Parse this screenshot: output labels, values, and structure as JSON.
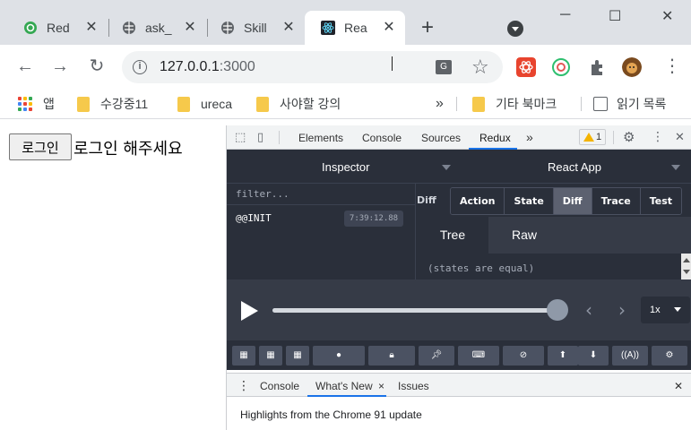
{
  "browser": {
    "tabs": [
      {
        "title": "Red",
        "icon": "redux-green-icon"
      },
      {
        "title": "ask_",
        "icon": "globe-icon"
      },
      {
        "title": "Skill",
        "icon": "globe-icon"
      },
      {
        "title": "Rea",
        "icon": "react-icon",
        "active": true
      }
    ],
    "new_tab_symbol": "+",
    "window_controls": {
      "minimize": "─",
      "maximize": "☐",
      "close": "✕"
    },
    "url_host": "127.0.0.1",
    "url_port": ":3000",
    "info_symbol": "i",
    "translate_label": "G",
    "star_symbol": "☆",
    "menu_symbol": "⋮"
  },
  "bookmarks": {
    "apps_label": "앱",
    "items": [
      "수강중11",
      "ureca",
      "사야할 강의"
    ],
    "overflow_symbol": "»",
    "other": "기타 북마크",
    "reading_list": "읽기 목록"
  },
  "page": {
    "login_button": "로그인",
    "login_message": "로그인 해주세요"
  },
  "devtools": {
    "tabs": [
      "Elements",
      "Console",
      "Sources",
      "Redux"
    ],
    "active_tab": "Redux",
    "more_symbol": "»",
    "warning_count": "1",
    "close_symbol": "✕",
    "settings_symbol": "⚙",
    "kebab_symbol": "⋮"
  },
  "redux": {
    "inspector_label": "Inspector",
    "instance_label": "React App",
    "filter_placeholder": "filter...",
    "actions": [
      {
        "name": "@@INIT",
        "time": "7:39:12.88"
      }
    ],
    "diff_label": "Diff",
    "monitor_tabs": [
      "Action",
      "State",
      "Diff",
      "Trace",
      "Test"
    ],
    "selected_monitor_tab": "Diff",
    "sub_tabs": [
      "Tree",
      "Raw"
    ],
    "selected_sub_tab": "Tree",
    "diff_message": "(states are equal)",
    "slider": {
      "position": 1.0,
      "speed": "1x"
    },
    "nav_prev": "‹",
    "nav_next": "›",
    "bottom_buttons": [
      "log-monitor-icon",
      "inspector-icon",
      "chart-icon",
      "record-icon",
      "lock-icon",
      "pin-icon",
      "keyboard-icon",
      "persist-off-icon",
      "upload-icon",
      "download-icon",
      "remote-icon",
      "settings-icon"
    ]
  },
  "drawer": {
    "kebab_symbol": "⋮",
    "tabs": [
      "Console",
      "What's New",
      "Issues"
    ],
    "active_tab": "What's New",
    "tab_close_symbol": "×",
    "close_symbol": "✕",
    "message": "Highlights from the Chrome 91 update"
  }
}
